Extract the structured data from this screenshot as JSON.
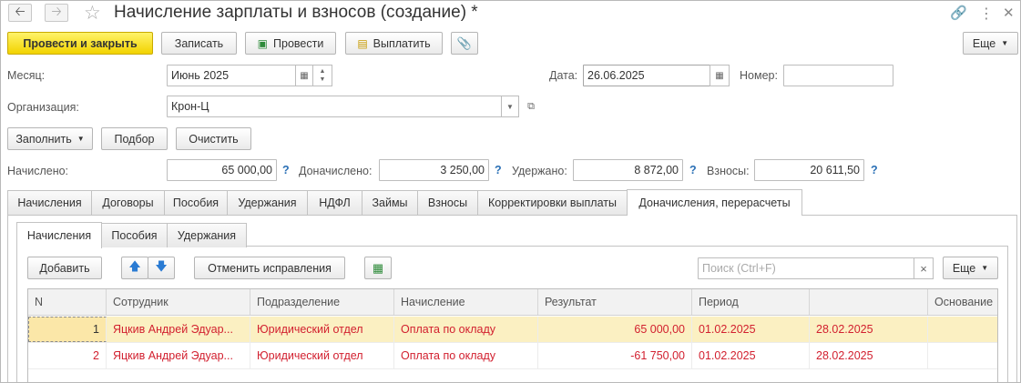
{
  "window": {
    "title": "Начисление зарплаты и взносов (создание) *"
  },
  "icons": {
    "back": "arrow-left-icon",
    "forward": "arrow-right-icon",
    "favorite": "star-icon",
    "link": "link-icon",
    "more": "kebab-menu-icon",
    "close": "close-icon"
  },
  "toolbar": {
    "post_close": "Провести и закрыть",
    "save": "Записать",
    "post": "Провести",
    "pay": "Выплатить",
    "more": "Еще"
  },
  "header": {
    "month_label": "Месяц:",
    "month_value": "Июнь 2025",
    "date_label": "Дата:",
    "date_value": "26.06.2025",
    "number_label": "Номер:",
    "number_value": "",
    "org_label": "Организация:",
    "org_value": "Крон-Ц"
  },
  "actions": {
    "fill": "Заполнить",
    "select": "Подбор",
    "clear": "Очистить"
  },
  "totals": {
    "accrued_label": "Начислено:",
    "accrued_value": "65 000,00",
    "extra_label": "Доначислено:",
    "extra_value": "3 250,00",
    "withheld_label": "Удержано:",
    "withheld_value": "8 872,00",
    "contrib_label": "Взносы:",
    "contrib_value": "20 611,50",
    "help": "?"
  },
  "tabs": [
    {
      "label": "Начисления"
    },
    {
      "label": "Договоры"
    },
    {
      "label": "Пособия"
    },
    {
      "label": "Удержания"
    },
    {
      "label": "НДФЛ"
    },
    {
      "label": "Займы"
    },
    {
      "label": "Взносы"
    },
    {
      "label": "Корректировки выплаты"
    },
    {
      "label": "Доначисления, перерасчеты"
    }
  ],
  "subtabs": [
    {
      "label": "Начисления"
    },
    {
      "label": "Пособия"
    },
    {
      "label": "Удержания"
    }
  ],
  "subtoolbar": {
    "add": "Добавить",
    "cancel_fix": "Отменить исправления",
    "search_placeholder": "Поиск (Ctrl+F)",
    "clear_search": "×",
    "more": "Еще"
  },
  "table": {
    "columns": [
      "N",
      "Сотрудник",
      "Подразделение",
      "Начисление",
      "Результат",
      "Период",
      "",
      "Основание"
    ],
    "rows": [
      {
        "n": "1",
        "employee": "Яцкив Андрей Эдуар...",
        "department": "Юридический отдел",
        "accrual": "Оплата по окладу",
        "result": "65 000,00",
        "period_from": "01.02.2025",
        "period_to": "28.02.2025",
        "basis": ""
      },
      {
        "n": "2",
        "employee": "Яцкив Андрей Эдуар...",
        "department": "Юридический отдел",
        "accrual": "Оплата по окладу",
        "result": "-61 750,00",
        "period_from": "01.02.2025",
        "period_to": "28.02.2025",
        "basis": ""
      }
    ]
  },
  "colors": {
    "primary_button": "#f5d900",
    "red_row": "#d2202f",
    "selected_row": "#fbf0c2",
    "help_icon": "#2a6fb5"
  }
}
